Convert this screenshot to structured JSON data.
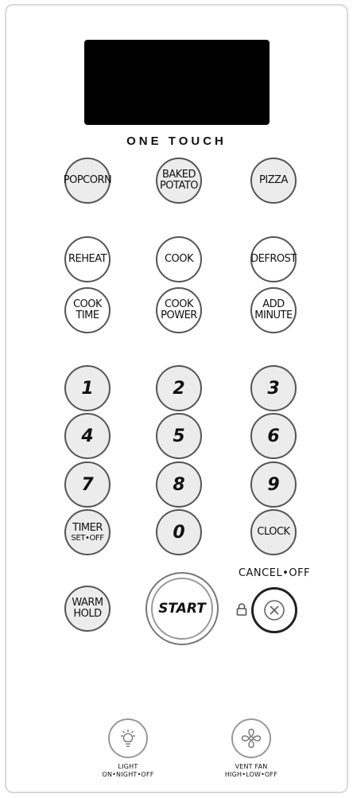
{
  "header": {
    "one_touch": "ONE TOUCH"
  },
  "one_touch": {
    "popcorn": "POPCORN",
    "baked_potato": "BAKED\nPOTATO",
    "pizza": "PIZZA"
  },
  "functions": {
    "reheat": "REHEAT",
    "cook": "COOK",
    "defrost": "DEFROST",
    "cook_time": "COOK\nTIME",
    "cook_power": "COOK\nPOWER",
    "add_minute": "ADD\nMINUTE"
  },
  "keypad": {
    "k1": "1",
    "k2": "2",
    "k3": "3",
    "k4": "4",
    "k5": "5",
    "k6": "6",
    "k7": "7",
    "k8": "8",
    "k9": "9",
    "k0": "0"
  },
  "timer": {
    "label": "TIMER",
    "sub": "SET•OFF"
  },
  "clock": "CLOCK",
  "warm_hold": "WARM\nHOLD",
  "start": "START",
  "cancel": {
    "label": "CANCEL•OFF"
  },
  "light": {
    "label": "LIGHT\nON•NIGHT•OFF"
  },
  "vent_fan": {
    "label": "VENT FAN\nHIGH•LOW•OFF"
  }
}
